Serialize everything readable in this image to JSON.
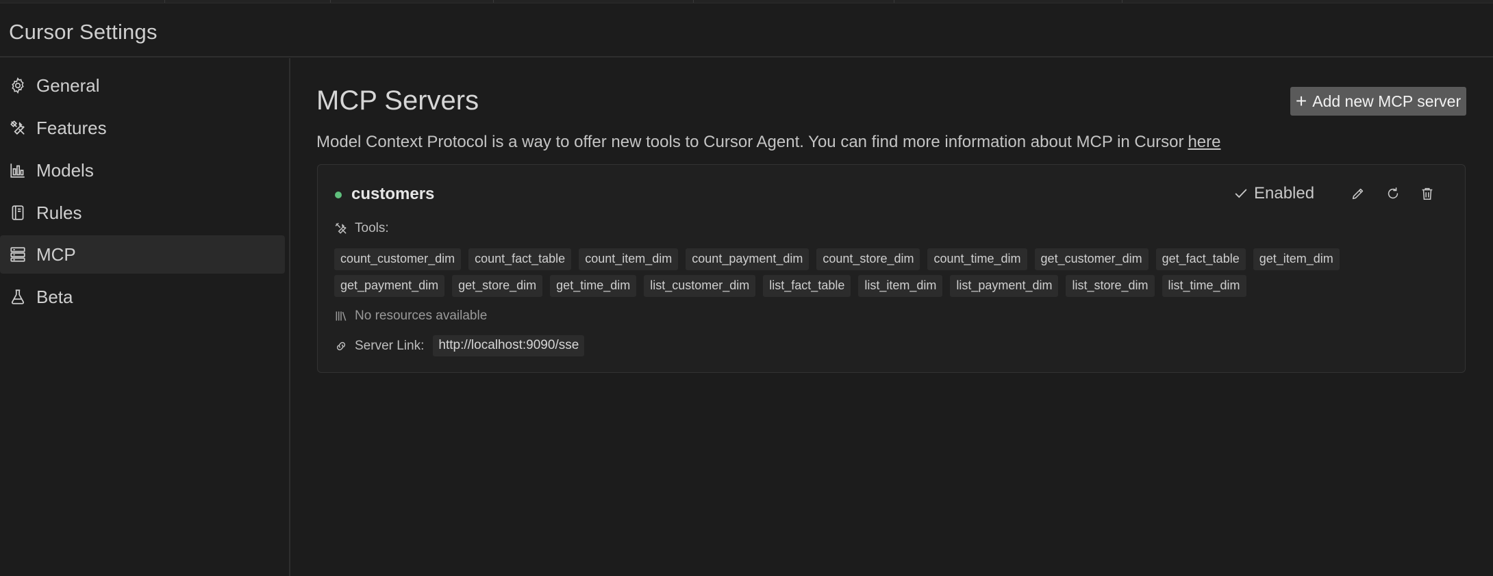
{
  "window": {
    "title": "Cursor Settings"
  },
  "sidebar": {
    "items": [
      {
        "label": "General",
        "icon": "gear-icon"
      },
      {
        "label": "Features",
        "icon": "tools-icon"
      },
      {
        "label": "Models",
        "icon": "chart-icon"
      },
      {
        "label": "Rules",
        "icon": "book-icon"
      },
      {
        "label": "MCP",
        "icon": "server-icon",
        "active": true
      },
      {
        "label": "Beta",
        "icon": "flask-icon"
      }
    ]
  },
  "main": {
    "title": "MCP Servers",
    "add_button_label": "Add new MCP server",
    "description": "Model Context Protocol is a way to offer new tools to Cursor Agent. You can find more information about MCP in Cursor",
    "description_link": "here"
  },
  "server": {
    "name": "customers",
    "status_color": "#5fbf7c",
    "enabled_label": "Enabled",
    "tools_label": "Tools:",
    "tools": [
      "count_customer_dim",
      "count_fact_table",
      "count_item_dim",
      "count_payment_dim",
      "count_store_dim",
      "count_time_dim",
      "get_customer_dim",
      "get_fact_table",
      "get_item_dim",
      "get_payment_dim",
      "get_store_dim",
      "get_time_dim",
      "list_customer_dim",
      "list_fact_table",
      "list_item_dim",
      "list_payment_dim",
      "list_store_dim",
      "list_time_dim"
    ],
    "resources_label": "No resources available",
    "link_label": "Server Link:",
    "link_value": "http://localhost:9090/sse"
  }
}
